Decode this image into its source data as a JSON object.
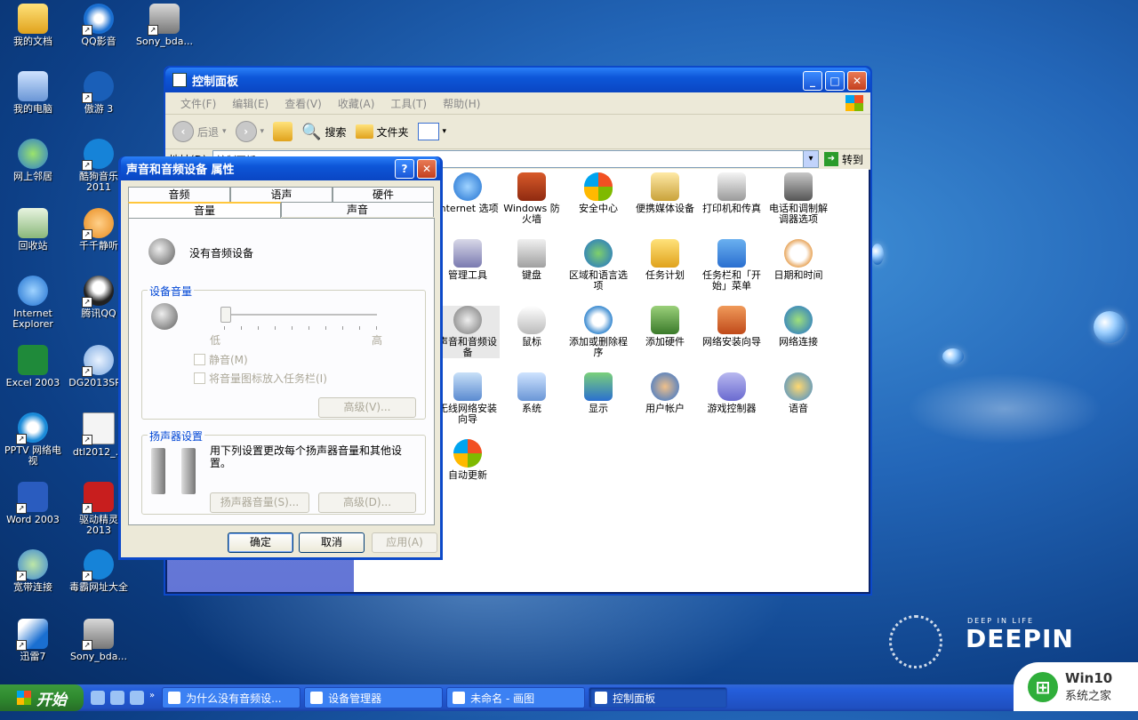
{
  "desktop_icons": [
    {
      "label": "我的文档"
    },
    {
      "label": "QQ影音"
    },
    {
      "label": "Sony_bda..."
    },
    {
      "label": "我的电脑"
    },
    {
      "label": "傲游 3"
    },
    {
      "label": "网上邻居"
    },
    {
      "label": "酷狗音乐 2011"
    },
    {
      "label": "回收站"
    },
    {
      "label": "千千静听"
    },
    {
      "label": "Internet Explorer"
    },
    {
      "label": "腾讯QQ"
    },
    {
      "label": "Excel 2003"
    },
    {
      "label": "DG2013SP..."
    },
    {
      "label": "PPTV 网络电视"
    },
    {
      "label": "dtl2012_..."
    },
    {
      "label": "Word 2003"
    },
    {
      "label": "驱动精灵 2013"
    },
    {
      "label": "宽带连接"
    },
    {
      "label": "毒霸网址大全"
    },
    {
      "label": "迅雷7"
    },
    {
      "label": "Sony_bda..."
    }
  ],
  "control_panel": {
    "title": "控制面板",
    "menu": [
      "文件(F)",
      "编辑(E)",
      "查看(V)",
      "收藏(A)",
      "工具(T)",
      "帮助(H)"
    ],
    "toolbar": {
      "back": "后退",
      "search": "搜索",
      "folders": "文件夹"
    },
    "address_label": "地址(D)",
    "address_value": "控制面板",
    "go_label": "转到",
    "items": [
      {
        "label": "Internet 选项"
      },
      {
        "label": "Windows 防火墙"
      },
      {
        "label": "安全中心"
      },
      {
        "label": "便携媒体设备"
      },
      {
        "label": "打印机和传真"
      },
      {
        "label": "电话和调制解调器选项"
      },
      {
        "label": "管理工具"
      },
      {
        "label": "键盘"
      },
      {
        "label": "区域和语言选项"
      },
      {
        "label": "任务计划"
      },
      {
        "label": "任务栏和「开始」菜单"
      },
      {
        "label": "日期和时间"
      },
      {
        "label": "声音和音频设备"
      },
      {
        "label": "鼠标"
      },
      {
        "label": "添加或删除程序"
      },
      {
        "label": "添加硬件"
      },
      {
        "label": "网络安装向导"
      },
      {
        "label": "网络连接"
      },
      {
        "label": "无线网络安装向导"
      },
      {
        "label": "系统"
      },
      {
        "label": "显示"
      },
      {
        "label": "用户帐户"
      },
      {
        "label": "游戏控制器"
      },
      {
        "label": "语音"
      },
      {
        "label": "自动更新"
      }
    ]
  },
  "dialog": {
    "title": "声音和音频设备 属性",
    "tabs_row1": [
      "音频",
      "语声",
      "硬件"
    ],
    "tabs_row2": [
      "音量",
      "声音"
    ],
    "no_device": "没有音频设备",
    "device_volume_label": "设备音量",
    "slider": {
      "low": "低",
      "high": "高",
      "level": 0
    },
    "mute": "静音(M)",
    "tray_icon": "将音量图标放入任务栏(I)",
    "advanced1": "高级(V)...",
    "speaker_group": "扬声器设置",
    "speaker_desc": "用下列设置更改每个扬声器音量和其他设置。",
    "speaker_volume_btn": "扬声器音量(S)...",
    "advanced2": "高级(D)...",
    "ok": "确定",
    "cancel": "取消",
    "apply": "应用(A)"
  },
  "taskbar": {
    "start": "开始",
    "tasks": [
      {
        "label": "为什么没有音频设..."
      },
      {
        "label": "设备管理器"
      },
      {
        "label": "未命名 - 画图"
      },
      {
        "label": "控制面板"
      }
    ]
  },
  "branding": {
    "deepin_tag": "DEEP IN LIFE",
    "deepin": "DEEPIN",
    "win10_title": "Win10",
    "win10_sub": "系统之家"
  }
}
